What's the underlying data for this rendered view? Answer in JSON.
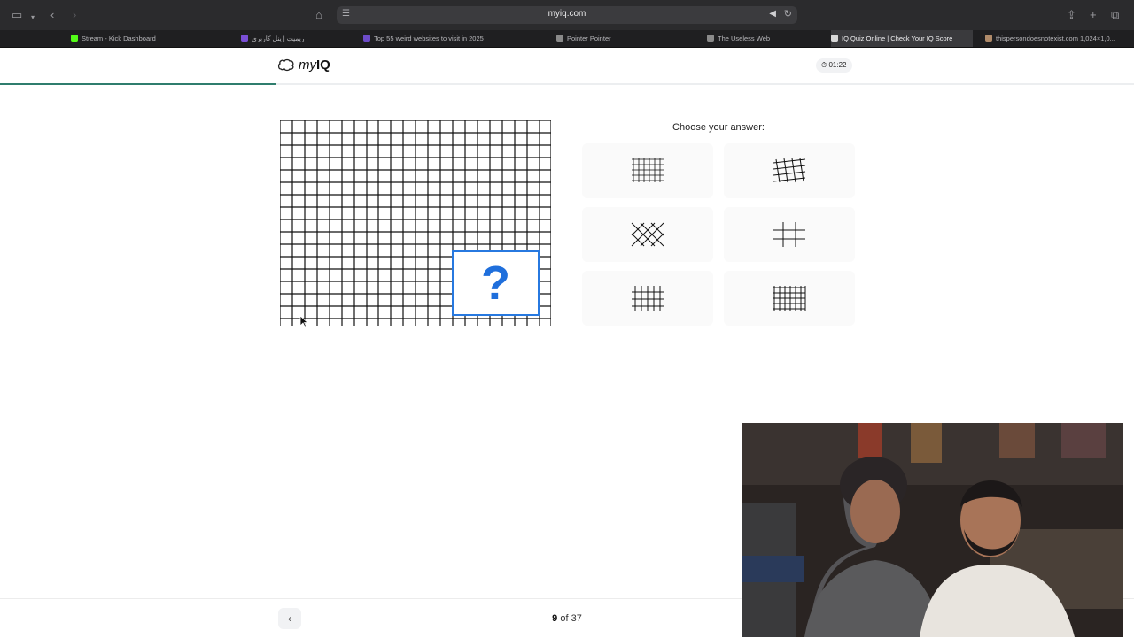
{
  "browser": {
    "url": "myiq.com",
    "tabs": [
      {
        "title": "Stream - Kick Dashboard",
        "color": "#53fc18",
        "active": false
      },
      {
        "title": "ریمیت | پنل کاربری",
        "color": "#7a4fd6",
        "active": false
      },
      {
        "title": "Top 55 weird websites to visit in 2025",
        "color": "#6d4cc9",
        "active": false
      },
      {
        "title": "Pointer Pointer",
        "color": "#8a8a8a",
        "active": false
      },
      {
        "title": "The Useless Web",
        "color": "#8a8a8a",
        "active": false
      },
      {
        "title": "IQ Quiz Online | Check Your IQ Score",
        "color": "#d8d8d8",
        "active": true
      },
      {
        "title": "thispersondoesnotexist.com 1,024×1,0...",
        "color": "#b08b6a",
        "active": false
      }
    ]
  },
  "site": {
    "logo_prefix": "my",
    "logo_bold": "IQ",
    "timer": "01:22",
    "progress": 0.243
  },
  "question": {
    "prompt": "Choose your answer:",
    "placeholder": "?",
    "options": [
      {
        "id": "A",
        "icon": "dense-grid-icon"
      },
      {
        "id": "B",
        "icon": "skewed-grid-icon"
      },
      {
        "id": "C",
        "icon": "diagonal-lattice-icon"
      },
      {
        "id": "D",
        "icon": "hash-icon"
      },
      {
        "id": "E",
        "icon": "vertical-grid-icon"
      },
      {
        "id": "F",
        "icon": "regular-grid-icon"
      }
    ]
  },
  "footer": {
    "current": "9",
    "of_label": "of",
    "total": "37"
  }
}
